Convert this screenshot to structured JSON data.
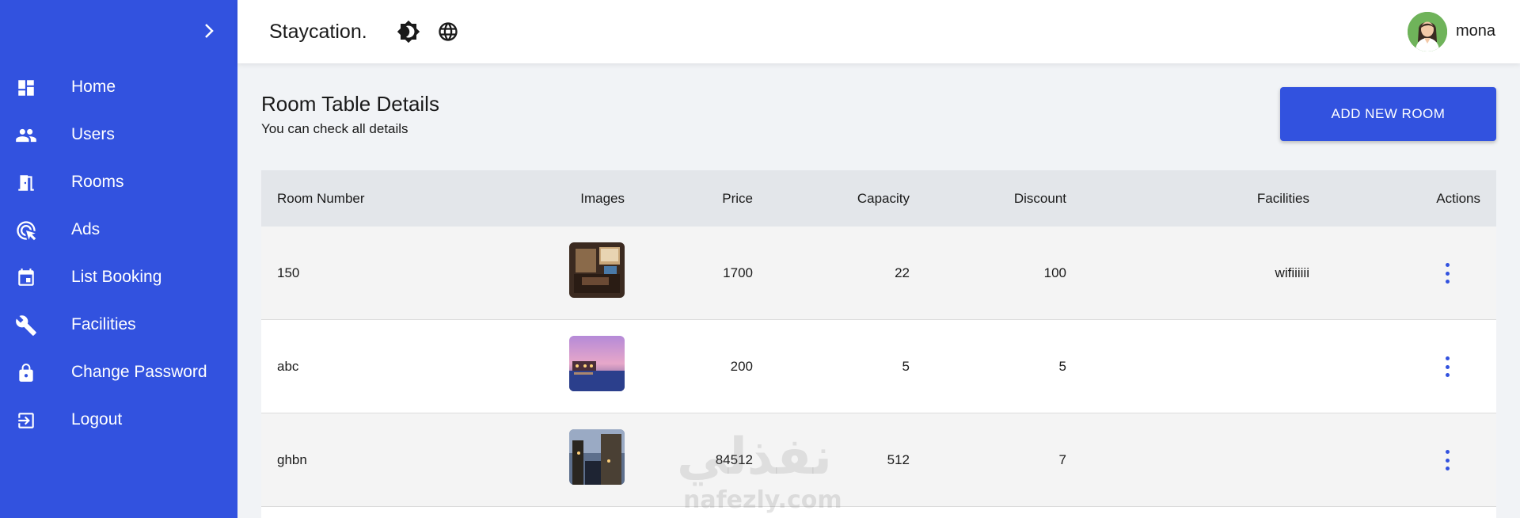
{
  "sidebar": {
    "items": [
      {
        "label": "Home",
        "icon": "dashboard-icon"
      },
      {
        "label": "Users",
        "icon": "users-icon"
      },
      {
        "label": "Rooms",
        "icon": "door-icon"
      },
      {
        "label": "Ads",
        "icon": "ads-click-icon"
      },
      {
        "label": "List Booking",
        "icon": "calendar-icon"
      },
      {
        "label": "Facilities",
        "icon": "wrench-icon"
      },
      {
        "label": "Change Password",
        "icon": "lock-icon"
      },
      {
        "label": "Logout",
        "icon": "logout-icon"
      }
    ]
  },
  "header": {
    "brand": "Staycation.",
    "user_name": "mona"
  },
  "main": {
    "title": "Room Table Details",
    "subtitle": "You can check all details",
    "add_button": "ADD NEW ROOM"
  },
  "table": {
    "columns": [
      "Room Number",
      "Images",
      "Price",
      "Capacity",
      "Discount",
      "Facilities",
      "Actions"
    ],
    "rows": [
      {
        "room_number": "150",
        "price": "1700",
        "capacity": "22",
        "discount": "100",
        "facilities": "wifiiiiii"
      },
      {
        "room_number": "abc",
        "price": "200",
        "capacity": "5",
        "discount": "5",
        "facilities": ""
      },
      {
        "room_number": "ghbn",
        "price": "84512",
        "capacity": "512",
        "discount": "7",
        "facilities": ""
      }
    ]
  },
  "watermark": {
    "arabic": "نفذلي",
    "latin": "nafezly.com"
  },
  "colors": {
    "primary": "#3252df",
    "background": "#f1f3f6",
    "table_header": "#e3e6ea"
  }
}
